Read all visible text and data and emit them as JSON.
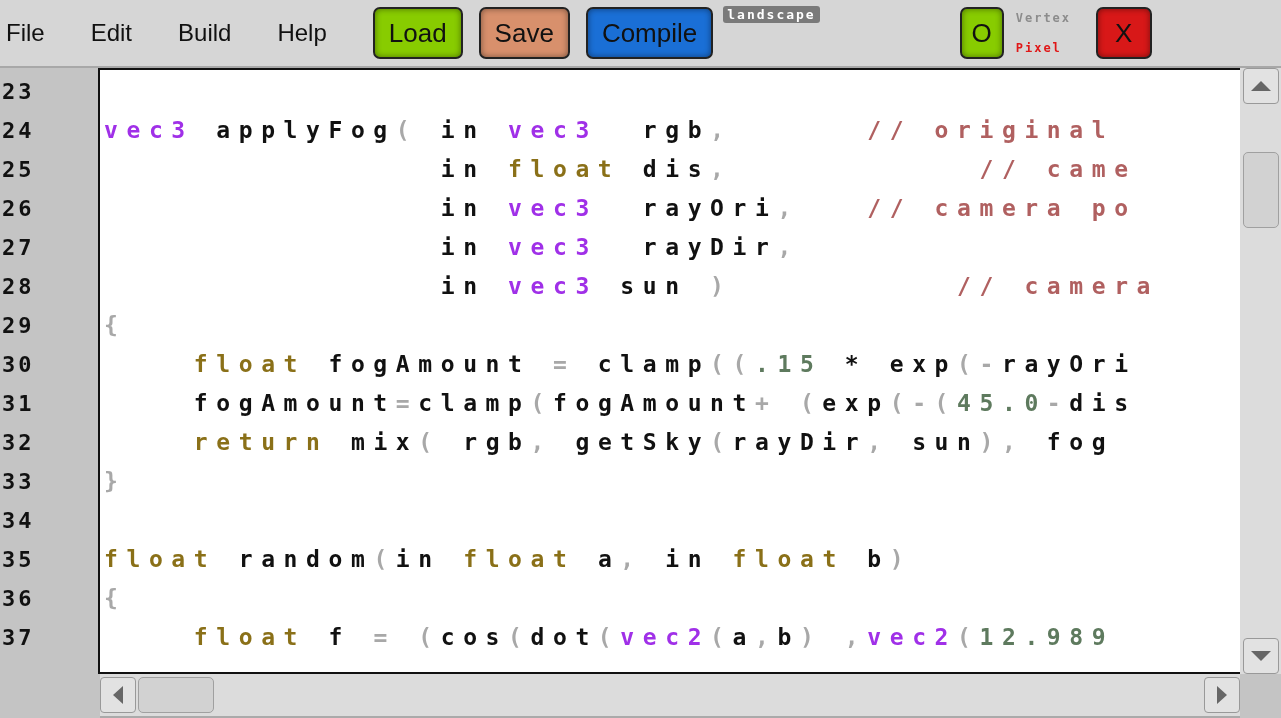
{
  "menu": [
    {
      "label": "File"
    },
    {
      "label": "Edit"
    },
    {
      "label": "Build"
    },
    {
      "label": "Help"
    }
  ],
  "actions": [
    {
      "label": "Load",
      "color": "#88cc00"
    },
    {
      "label": "Save",
      "color": "#d8906c"
    },
    {
      "label": "Compile",
      "color": "#1a6fd6"
    }
  ],
  "project_name": "landscape",
  "ok_button": {
    "label": "O",
    "color": "#88cc00"
  },
  "shader_modes": [
    {
      "label": "Vertex",
      "selected": false
    },
    {
      "label": "Pixel",
      "selected": true
    }
  ],
  "close_button": {
    "label": "X",
    "color": "#d81818"
  },
  "editor": {
    "lines": [
      {
        "number": "23"
      },
      {
        "number": "24",
        "tokens": [
          {
            "kind": "type",
            "text": "vec3"
          },
          {
            "kind": "plain",
            "text": " applyFog"
          },
          {
            "kind": "punct",
            "text": "("
          },
          {
            "kind": "plain",
            "text": " in "
          },
          {
            "kind": "type",
            "text": "vec3"
          },
          {
            "kind": "plain",
            "text": "  rgb"
          },
          {
            "kind": "punct",
            "text": ","
          },
          {
            "kind": "comment",
            "text": "      // original"
          }
        ]
      },
      {
        "number": "25",
        "tokens": [
          {
            "kind": "plain",
            "text": "               in "
          },
          {
            "kind": "kw",
            "text": "float"
          },
          {
            "kind": "plain",
            "text": " dis"
          },
          {
            "kind": "punct",
            "text": ","
          },
          {
            "kind": "comment",
            "text": "           // came"
          }
        ]
      },
      {
        "number": "26",
        "tokens": [
          {
            "kind": "plain",
            "text": "               in "
          },
          {
            "kind": "type",
            "text": "vec3"
          },
          {
            "kind": "plain",
            "text": "  rayOri"
          },
          {
            "kind": "punct",
            "text": ","
          },
          {
            "kind": "comment",
            "text": "   // camera po"
          }
        ]
      },
      {
        "number": "27",
        "tokens": [
          {
            "kind": "plain",
            "text": "               in "
          },
          {
            "kind": "type",
            "text": "vec3"
          },
          {
            "kind": "plain",
            "text": "  rayDir"
          },
          {
            "kind": "punct",
            "text": ","
          }
        ]
      },
      {
        "number": "28",
        "tokens": [
          {
            "kind": "plain",
            "text": "               in "
          },
          {
            "kind": "type",
            "text": "vec3"
          },
          {
            "kind": "plain",
            "text": " sun "
          },
          {
            "kind": "punct",
            "text": ")"
          },
          {
            "kind": "comment",
            "text": "          // camera"
          }
        ]
      },
      {
        "number": "29",
        "tokens": [
          {
            "kind": "punct",
            "text": "{"
          }
        ]
      },
      {
        "number": "30",
        "tokens": [
          {
            "kind": "kw",
            "text": "    float"
          },
          {
            "kind": "plain",
            "text": " fogAmount "
          },
          {
            "kind": "punct",
            "text": "="
          },
          {
            "kind": "plain",
            "text": " clamp"
          },
          {
            "kind": "punct",
            "text": "(("
          },
          {
            "kind": "num",
            "text": ".15"
          },
          {
            "kind": "plain",
            "text": " * exp"
          },
          {
            "kind": "punct",
            "text": "(-"
          },
          {
            "kind": "plain",
            "text": "rayOri"
          }
        ]
      },
      {
        "number": "31",
        "tokens": [
          {
            "kind": "plain",
            "text": "    fogAmount"
          },
          {
            "kind": "punct",
            "text": "="
          },
          {
            "kind": "plain",
            "text": "clamp"
          },
          {
            "kind": "punct",
            "text": "("
          },
          {
            "kind": "plain",
            "text": "fogAmount"
          },
          {
            "kind": "punct",
            "text": "+ ("
          },
          {
            "kind": "plain",
            "text": "exp"
          },
          {
            "kind": "punct",
            "text": "(-("
          },
          {
            "kind": "num",
            "text": "45.0"
          },
          {
            "kind": "punct",
            "text": "-"
          },
          {
            "kind": "plain",
            "text": "dis"
          }
        ]
      },
      {
        "number": "32",
        "tokens": [
          {
            "kind": "kw",
            "text": "    return"
          },
          {
            "kind": "plain",
            "text": " mix"
          },
          {
            "kind": "punct",
            "text": "("
          },
          {
            "kind": "plain",
            "text": " rgb"
          },
          {
            "kind": "punct",
            "text": ","
          },
          {
            "kind": "plain",
            "text": " getSky"
          },
          {
            "kind": "punct",
            "text": "("
          },
          {
            "kind": "plain",
            "text": "rayDir"
          },
          {
            "kind": "punct",
            "text": ","
          },
          {
            "kind": "plain",
            "text": " sun"
          },
          {
            "kind": "punct",
            "text": "),"
          },
          {
            "kind": "plain",
            "text": " fog"
          }
        ]
      },
      {
        "number": "33",
        "tokens": [
          {
            "kind": "punct",
            "text": "}"
          }
        ]
      },
      {
        "number": "34"
      },
      {
        "number": "35",
        "tokens": [
          {
            "kind": "kw",
            "text": "float"
          },
          {
            "kind": "plain",
            "text": " random"
          },
          {
            "kind": "punct",
            "text": "("
          },
          {
            "kind": "plain",
            "text": "in "
          },
          {
            "kind": "kw",
            "text": "float"
          },
          {
            "kind": "plain",
            "text": " a"
          },
          {
            "kind": "punct",
            "text": ","
          },
          {
            "kind": "plain",
            "text": " in "
          },
          {
            "kind": "kw",
            "text": "float"
          },
          {
            "kind": "plain",
            "text": " b"
          },
          {
            "kind": "punct",
            "text": ")"
          }
        ]
      },
      {
        "number": "36",
        "tokens": [
          {
            "kind": "punct",
            "text": "{"
          }
        ]
      },
      {
        "number": "37",
        "tokens": [
          {
            "kind": "kw",
            "text": "    float"
          },
          {
            "kind": "plain",
            "text": " f "
          },
          {
            "kind": "punct",
            "text": "= ("
          },
          {
            "kind": "plain",
            "text": "cos"
          },
          {
            "kind": "punct",
            "text": "("
          },
          {
            "kind": "plain",
            "text": "dot"
          },
          {
            "kind": "punct",
            "text": "("
          },
          {
            "kind": "type",
            "text": "vec2"
          },
          {
            "kind": "punct",
            "text": "("
          },
          {
            "kind": "plain",
            "text": "a"
          },
          {
            "kind": "punct",
            "text": ","
          },
          {
            "kind": "plain",
            "text": "b"
          },
          {
            "kind": "punct",
            "text": ") ,"
          },
          {
            "kind": "type",
            "text": "vec2"
          },
          {
            "kind": "punct",
            "text": "("
          },
          {
            "kind": "num",
            "text": "12.989"
          }
        ]
      }
    ]
  }
}
